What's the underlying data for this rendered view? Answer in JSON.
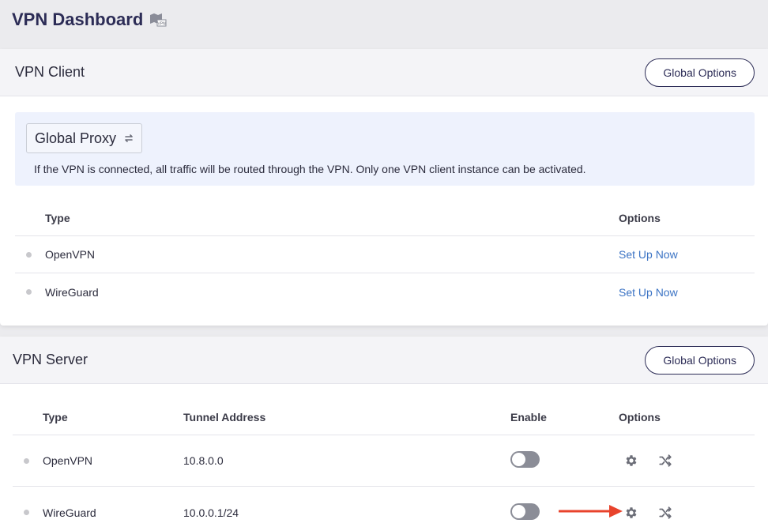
{
  "page": {
    "title": "VPN Dashboard",
    "icon": "vpn-map-icon"
  },
  "client": {
    "title": "VPN Client",
    "global_options_label": "Global Options",
    "proxy_mode": {
      "selected": "Global Proxy",
      "icon": "swap-icon"
    },
    "info_text": "If the VPN is connected, all traffic will be routed through the VPN. Only one VPN client instance can be activated.",
    "columns": {
      "type": "Type",
      "options": "Options"
    },
    "rows": [
      {
        "type": "OpenVPN",
        "action": "Set Up Now"
      },
      {
        "type": "WireGuard",
        "action": "Set Up Now"
      }
    ]
  },
  "server": {
    "title": "VPN Server",
    "global_options_label": "Global Options",
    "columns": {
      "type": "Type",
      "tunnel": "Tunnel Address",
      "enable": "Enable",
      "options": "Options"
    },
    "rows": [
      {
        "type": "OpenVPN",
        "tunnel": "10.8.0.0",
        "enabled": false
      },
      {
        "type": "WireGuard",
        "tunnel": "10.0.0.1/24",
        "enabled": false
      }
    ]
  },
  "colors": {
    "accent": "#2c2c56",
    "link": "#3b73c4",
    "annotation_arrow": "#e8432c",
    "info_bg": "#eef2fd"
  }
}
